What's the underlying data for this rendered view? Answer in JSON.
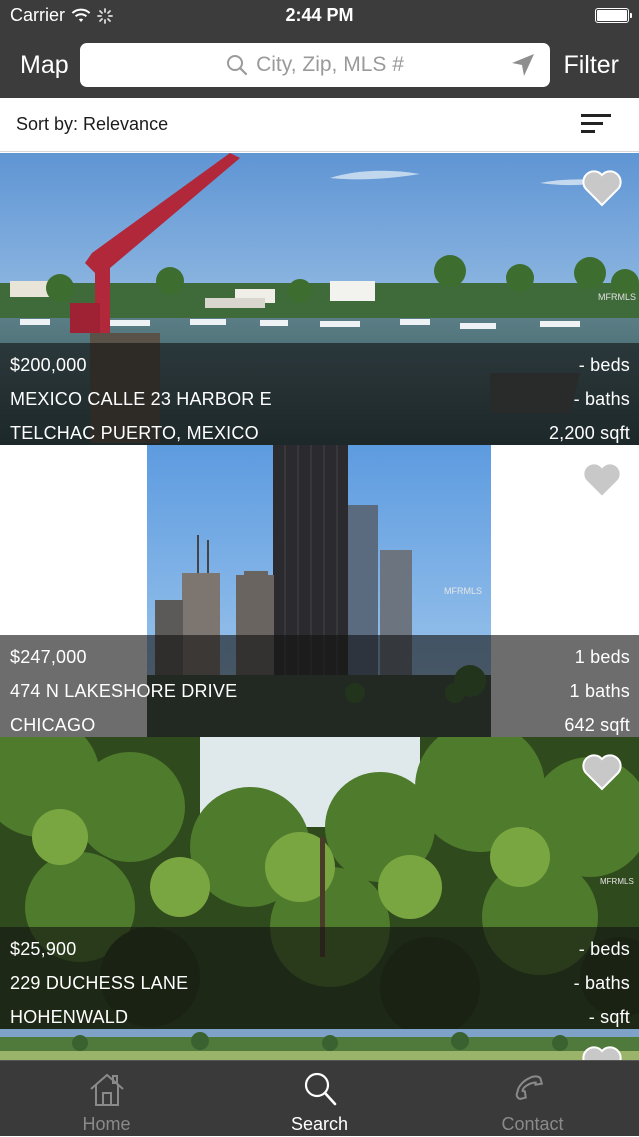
{
  "status": {
    "carrier": "Carrier",
    "time": "2:44 PM"
  },
  "nav": {
    "map_label": "Map",
    "filter_label": "Filter",
    "search_placeholder": "City, Zip, MLS #"
  },
  "sort": {
    "label": "Sort by: Relevance"
  },
  "listings": [
    {
      "price": "$200,000",
      "address": "MEXICO CALLE 23 HARBOR E",
      "city": "TELCHAC PUERTO, MEXICO",
      "beds": "- beds",
      "baths": "- baths",
      "sqft": "2,200 sqft",
      "watermark": "MFRMLS"
    },
    {
      "price": "$247,000",
      "address": "474 N LAKESHORE DRIVE",
      "city": "CHICAGO",
      "beds": "1 beds",
      "baths": "1 baths",
      "sqft": "642 sqft",
      "watermark": "MFRMLS"
    },
    {
      "price": "$25,900",
      "address": "229 DUCHESS LANE",
      "city": "HOHENWALD",
      "beds": "- beds",
      "baths": "- baths",
      "sqft": "- sqft",
      "watermark": "MFRMLS"
    }
  ],
  "tabs": [
    {
      "label": "Home",
      "icon": "house-icon",
      "active": false
    },
    {
      "label": "Search",
      "icon": "magnifier-icon",
      "active": true
    },
    {
      "label": "Contact",
      "icon": "phone-icon",
      "active": false
    }
  ],
  "colors": {
    "bar": "#3c3c3c",
    "tab_active": "#ffffff",
    "tab_inactive": "#8a8a8a",
    "favorite": "#c8c8c8"
  }
}
